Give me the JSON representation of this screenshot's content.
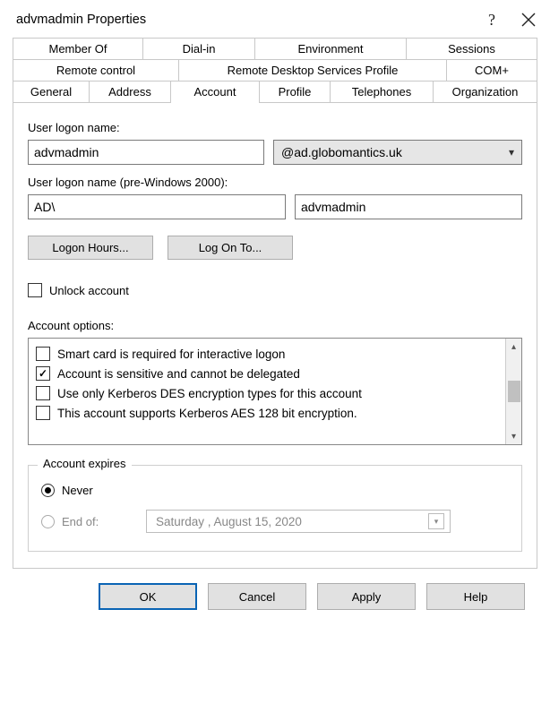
{
  "title": "advmadmin Properties",
  "tabs": {
    "row1": [
      "Member Of",
      "Dial-in",
      "Environment",
      "Sessions"
    ],
    "row2": [
      "Remote control",
      "Remote Desktop Services Profile",
      "COM+"
    ],
    "row3": [
      "General",
      "Address",
      "Account",
      "Profile",
      "Telephones",
      "Organization"
    ],
    "active": "Account"
  },
  "account": {
    "logon_label": "User logon name:",
    "logon_value": "advmadmin",
    "domain_selected": "@ad.globomantics.uk",
    "pre2000_label": "User logon name (pre-Windows 2000):",
    "pre2000_domain": "AD\\",
    "pre2000_user": "advmadmin",
    "logon_hours_btn": "Logon Hours...",
    "log_on_to_btn": "Log On To...",
    "unlock_label": "Unlock account",
    "unlock_checked": false,
    "options_label": "Account options:",
    "options": [
      {
        "label": "Smart card is required for interactive logon",
        "checked": false
      },
      {
        "label": "Account is sensitive and cannot be delegated",
        "checked": true
      },
      {
        "label": "Use only Kerberos DES encryption types for this account",
        "checked": false
      },
      {
        "label": "This account supports Kerberos AES 128 bit encryption.",
        "checked": false
      }
    ],
    "expires": {
      "group_title": "Account expires",
      "never_label": "Never",
      "endof_label": "End of:",
      "selected": "never",
      "date_text": "Saturday  ,   August   15, 2020"
    }
  },
  "buttons": {
    "ok": "OK",
    "cancel": "Cancel",
    "apply": "Apply",
    "help": "Help"
  }
}
